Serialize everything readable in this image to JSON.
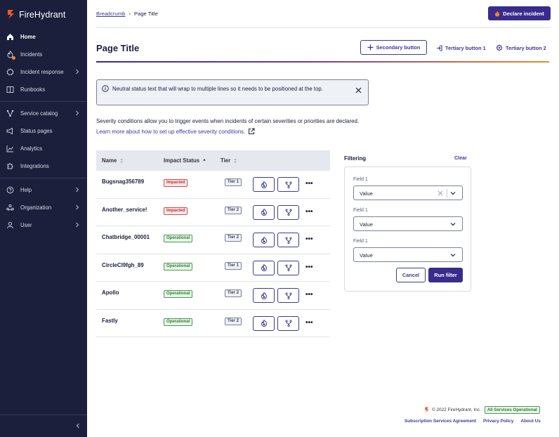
{
  "app": {
    "name": "FireHydrant"
  },
  "sidebar": {
    "groups": [
      [
        {
          "label": "Home",
          "icon": "home-icon",
          "active": true
        },
        {
          "label": "Incidents",
          "icon": "fire-icon",
          "badge": true
        },
        {
          "label": "Incident response",
          "icon": "gear-icon",
          "chevron": true
        },
        {
          "label": "Runbooks",
          "icon": "book-icon"
        }
      ],
      [
        {
          "label": "Service catalog",
          "icon": "graph-icon",
          "chevron": true
        },
        {
          "label": "Status pages",
          "icon": "megaphone-icon"
        },
        {
          "label": "Analytics",
          "icon": "chart-icon"
        },
        {
          "label": "Integrations",
          "icon": "puzzle-icon"
        }
      ],
      [
        {
          "label": "Help",
          "icon": "help-icon",
          "chevron": true
        },
        {
          "label": "Organization",
          "icon": "org-icon",
          "chevron": true
        },
        {
          "label": "User",
          "icon": "user-icon",
          "chevron": true
        }
      ]
    ]
  },
  "topbar": {
    "breadcrumb": "Breadcrumb",
    "page": "Page Title",
    "declare_label": "Declare incident"
  },
  "header": {
    "title": "Page Title",
    "secondary_label": "Secondary button",
    "tertiary1_label": "Tertiary button 1",
    "tertiary2_label": "Tertiary button 2"
  },
  "alert": {
    "text": "Neutral status text that will wrap to multiple lines so it needs to be positioned at the top."
  },
  "description": "Severity conditions allow you to trigger events when incidents of certain severities or priorities are declared.",
  "learn_link": "Learn more about how to set up effective severity conditions.",
  "table": {
    "headers": {
      "name": "Name",
      "status": "Impact Status",
      "tier": "Tier"
    },
    "rows": [
      {
        "name": "Bugsnag356789",
        "status": "Impacted",
        "status_kind": "impacted",
        "tier": "Tier 1"
      },
      {
        "name": "Another_service!",
        "status": "Impacted",
        "status_kind": "impacted",
        "tier": "Tier 2"
      },
      {
        "name": "Chatbridge_00001",
        "status": "Operational",
        "status_kind": "operational",
        "tier": "Tier 2"
      },
      {
        "name": "CircleCI9fgh_89",
        "status": "Operational",
        "status_kind": "operational",
        "tier": "Tier 1"
      },
      {
        "name": "Apollo",
        "status": "Operational",
        "status_kind": "operational",
        "tier": "Tier 2"
      },
      {
        "name": "Fastly",
        "status": "Operational",
        "status_kind": "operational",
        "tier": "Tier 2"
      }
    ],
    "more_label": "•••"
  },
  "filter": {
    "title": "Filtering",
    "clear_label": "Clear",
    "fields": [
      {
        "label": "Field 1",
        "value": "Value",
        "clearable": true
      },
      {
        "label": "Field 1",
        "value": "Value"
      },
      {
        "label": "Field 1",
        "value": "Value"
      }
    ],
    "cancel_label": "Cancel",
    "run_label": "Run filter"
  },
  "footer": {
    "copyright": "© 2022 FireHydrant, Inc.",
    "status": "All Services Operational",
    "links": [
      "Subscription Services Agreement",
      "Privacy Policy",
      "About Us"
    ]
  },
  "colors": {
    "sidebar": "#1b1f3b",
    "primary": "#3a2c8c",
    "accent": "#f08a24"
  }
}
